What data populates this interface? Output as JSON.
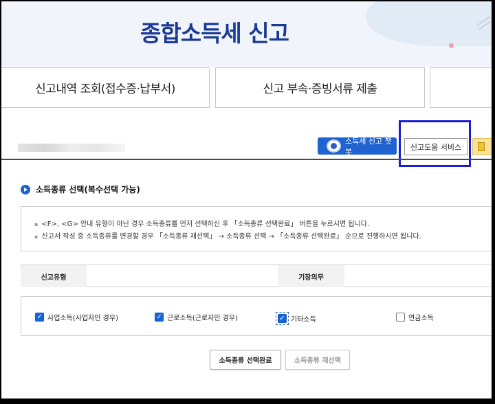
{
  "header": {
    "title": "종합소득세 신고"
  },
  "tabs": [
    {
      "label": "신고내역 조회(접수증·납부서)"
    },
    {
      "label": "신고 부속·증빙서류 제출"
    },
    {
      "label": ""
    }
  ],
  "toolbar": {
    "chatbot_label": "소득세 신고 챗봇",
    "help_label": "신고도움 서비스",
    "highlight_color": "#1c1cd4"
  },
  "section": {
    "title": "소득종류 선택(복수선택 가능)"
  },
  "notice": {
    "lines": [
      "<F>, <G> 안내 유형이 아닌 경우 소득종류를 먼저 선택하신 후 「소득종류 선택완료」 버튼을 누르시면 됩니다.",
      "신고서 작성 중 소득종류를 변경할 경우 「소득종류 재선택」 → 소득종류 선택 → 「소득종류 선택완료」 순으로 진행하시면 됩니다."
    ]
  },
  "type_table": {
    "col1_header": "신고유형",
    "col1_value": "",
    "col2_header": "기장의무",
    "col2_value": ""
  },
  "income_types": [
    {
      "label": "사업소득(사업자인 경우)",
      "checked": true
    },
    {
      "label": "근로소득(근로자인 경우)",
      "checked": true
    },
    {
      "label": "기타소득",
      "checked": true
    },
    {
      "label": "연금소득",
      "checked": false
    }
  ],
  "buttons": {
    "complete_label": "소득종류 선택완료",
    "reselect_label": "소득종류 재선택"
  },
  "colors": {
    "brand_blue": "#1b3a94",
    "checkbox_blue": "#1a65d6",
    "chatbot_blue": "#1f62d0"
  }
}
